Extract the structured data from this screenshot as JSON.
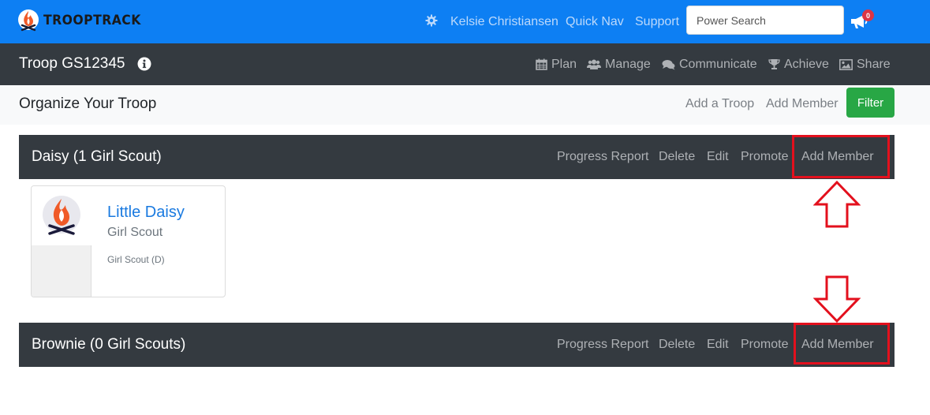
{
  "topbar": {
    "brand": "TROOPTRACK",
    "user_name": "Kelsie Christiansen",
    "quick_nav": "Quick Nav",
    "support": "Support",
    "search_placeholder": "Power Search",
    "notification_count": "0",
    "icons": {
      "settings": "gear-icon",
      "notifications": "megaphone-icon"
    },
    "background_color": "#0d7ff3"
  },
  "troopbar": {
    "title": "Troop GS12345",
    "nav": [
      {
        "label": "Plan",
        "icon": "calendar-icon"
      },
      {
        "label": "Manage",
        "icon": "users-icon"
      },
      {
        "label": "Communicate",
        "icon": "comments-icon"
      },
      {
        "label": "Achieve",
        "icon": "trophy-icon"
      },
      {
        "label": "Share",
        "icon": "image-icon"
      }
    ]
  },
  "subbar": {
    "title": "Organize Your Troop",
    "add_troop": "Add a Troop",
    "add_member": "Add Member",
    "filter": "Filter",
    "filter_color": "#28a745"
  },
  "levels": [
    {
      "title": "Daisy (1 Girl Scout)",
      "actions": [
        "Progress Report",
        "Delete",
        "Edit",
        "Promote",
        "Add Member"
      ],
      "members": [
        {
          "name": "Little Daisy",
          "role": "Girl Scout",
          "detail": "Girl Scout (D)"
        }
      ]
    },
    {
      "title": "Brownie (0 Girl Scouts)",
      "actions": [
        "Progress Report",
        "Delete",
        "Edit",
        "Promote",
        "Add Member"
      ],
      "members": []
    }
  ],
  "annotation_color": "#e3101d"
}
